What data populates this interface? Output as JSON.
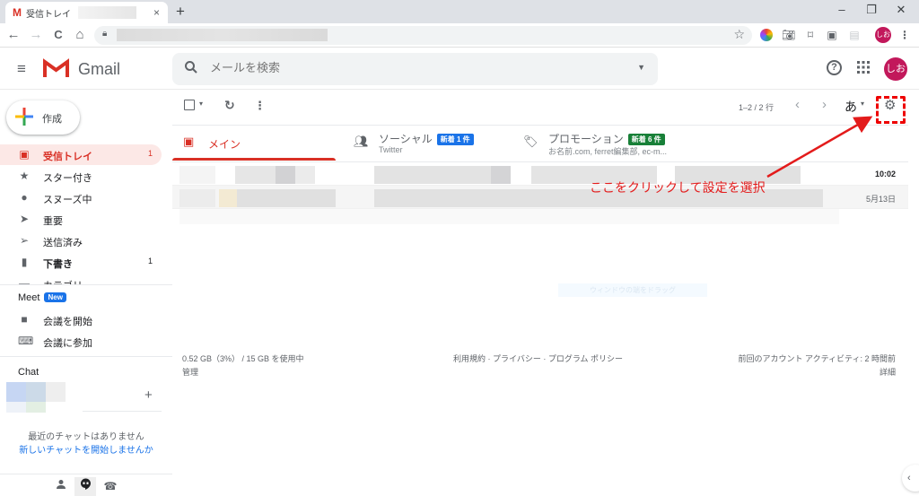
{
  "browser": {
    "tab_title": "受信トレイ",
    "favicon": "M",
    "tab_close": "×",
    "new_tab": "+",
    "window_controls": {
      "minimize": "–",
      "restore": "❐",
      "close": "✕"
    },
    "nav": {
      "back": "←",
      "forward": "→",
      "reload": "C",
      "home": "⌂"
    },
    "bookmark_star": "☆",
    "profile_initials": "しお",
    "menu": "⋮"
  },
  "header": {
    "menu_icon": "≡",
    "app_name": "Gmail",
    "search_placeholder": "メールを検索",
    "search_icon": "⚲",
    "search_options": "▼",
    "help_icon": "?",
    "apps_icon": "⋮⋮⋮",
    "account_initials": "しお"
  },
  "sidebar": {
    "compose_label": "作成",
    "items": [
      {
        "label": "受信トレイ",
        "count": "1",
        "icon": "inbox",
        "active": true
      },
      {
        "label": "スター付き",
        "count": "",
        "icon": "star"
      },
      {
        "label": "スヌーズ中",
        "count": "",
        "icon": "clock"
      },
      {
        "label": "重要",
        "count": "",
        "icon": "important"
      },
      {
        "label": "送信済み",
        "count": "",
        "icon": "send"
      },
      {
        "label": "下書き",
        "count": "1",
        "icon": "draft"
      },
      {
        "label": "カテゴリ",
        "count": "",
        "icon": "category"
      }
    ],
    "meet": {
      "title": "Meet",
      "badge": "New",
      "items": [
        {
          "label": "会議を開始",
          "icon": "video"
        },
        {
          "label": "会議に参加",
          "icon": "keyboard"
        }
      ]
    },
    "chat": {
      "title": "Chat",
      "add": "+",
      "empty_line1": "最近のチャットはありません",
      "empty_line2": "新しいチャットを開始しませんか"
    }
  },
  "toolbar": {
    "select_dropdown": "▾",
    "refresh": "↻",
    "more": "⋮",
    "pagination": "1–2 / 2 行",
    "prev": "‹",
    "next": "›",
    "input_tool": "あ",
    "input_tool_caret": "▾",
    "settings": "⚙"
  },
  "categories": [
    {
      "label": "メイン",
      "sub": "",
      "badge": "",
      "badge_color": "",
      "active": true
    },
    {
      "label": "ソーシャル",
      "sub": "Twitter",
      "badge": "新着 1 件",
      "badge_color": "#1a73e8"
    },
    {
      "label": "プロモーション",
      "sub": "お名前.com, ferret編集部, ec-m...",
      "badge": "新着 6 件",
      "badge_color": "#188038"
    }
  ],
  "mails": [
    {
      "date": "10:02",
      "unread": true
    },
    {
      "date": "5月13日",
      "unread": false
    }
  ],
  "footer": {
    "storage": "0.52 GB（3%） / 15 GB を使用中",
    "manage": "管理",
    "links": "利用規約 · プライバシー · プログラム ポリシー",
    "activity": "前回のアカウント アクティビティ: 2 時間前",
    "details": "詳細",
    "loading_hint": "ウィンドウの端をドラッグ"
  },
  "annotation": {
    "text": "ここをクリックして設定を選択",
    "color": "#e31b1b"
  },
  "hangouts": {
    "contacts": "👤",
    "chat": "💬",
    "phone": "☎"
  },
  "side_panel_toggle": "‹"
}
